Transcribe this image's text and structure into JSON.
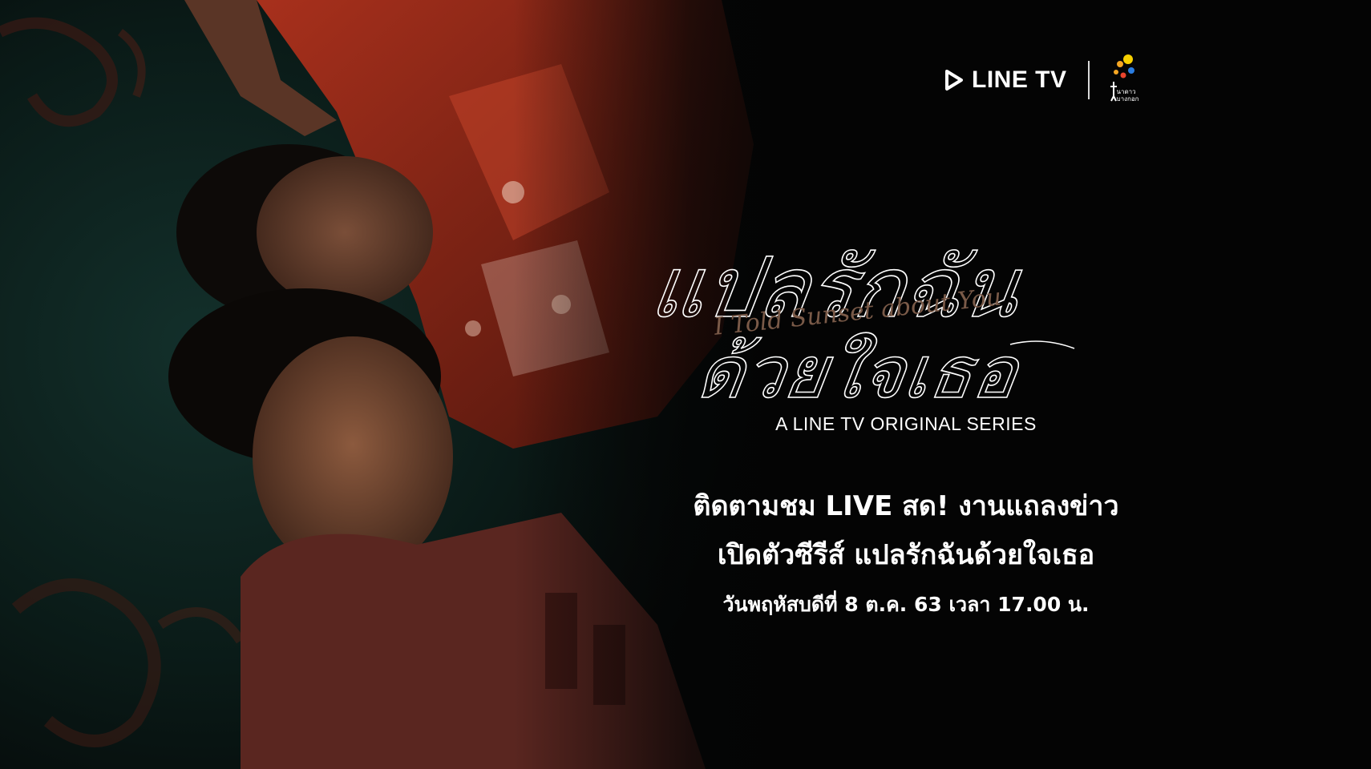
{
  "logos": {
    "linetv": "LINE TV",
    "nadao_line1": "นาดาว",
    "nadao_line2": "บางกอก"
  },
  "title": {
    "thai_line1": "แปลรักฉัน",
    "thai_line2": "ด้วยใจเธอ",
    "english_script": "I Told Sunset about You"
  },
  "series_label": "A LINE TV ORIGINAL SERIES",
  "announcement": {
    "line1": "ติดตามชม LIVE สด! งานแถลงข่าว",
    "line2": "เปิดตัวซีรีส์ แปลรักฉันด้วยใจเธอ",
    "line3": "วันพฤหัสบดีที่ 8 ต.ค. 63 เวลา 17.00 น."
  },
  "colors": {
    "background": "#040404",
    "text": "#ffffff",
    "shirt_red": "#8a2416",
    "tshirt_maroon": "#5a2620",
    "carpet_teal": "#0f2622",
    "script_brown": "#7a5a48",
    "nadao_dots": [
      "#f5a623",
      "#f7d000",
      "#2a7de1",
      "#e8442d"
    ]
  },
  "icons": {
    "linetv": "play-triangle-icon",
    "nadao": "nadao-bangkok-logo-icon"
  }
}
